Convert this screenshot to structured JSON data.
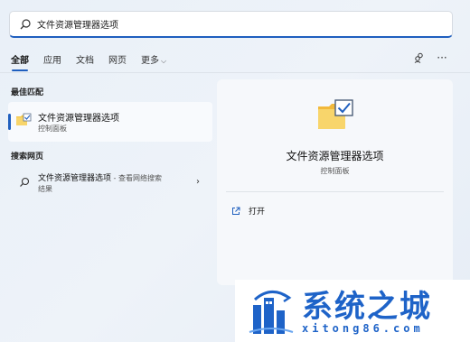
{
  "search": {
    "value": "文件资源管理器选项",
    "icon": "search-icon"
  },
  "tabs": [
    {
      "label": "全部",
      "active": true
    },
    {
      "label": "应用"
    },
    {
      "label": "文档"
    },
    {
      "label": "网页"
    },
    {
      "label": "更多"
    }
  ],
  "toolbar": {
    "icons": [
      "account-switch-icon",
      "more-options-icon"
    ]
  },
  "best_match": {
    "title": "最佳匹配",
    "item": {
      "name": "文件资源管理器选项",
      "subtitle": "控制面板",
      "icon": "folder-check-icon"
    }
  },
  "web_search": {
    "title": "搜索网页",
    "item": {
      "name": "文件资源管理器选项",
      "suffix": " - 查看网络搜索",
      "line2": "结果"
    }
  },
  "preview": {
    "name": "文件资源管理器选项",
    "subtitle": "控制面板",
    "action": "打开",
    "icon": "folder-check-icon"
  },
  "watermark": {
    "brand": "系统之城",
    "url": "xitong86.com"
  },
  "colors": {
    "accent": "#1f5fbf",
    "brand": "#1e63c8",
    "folder": "#f5c542"
  }
}
